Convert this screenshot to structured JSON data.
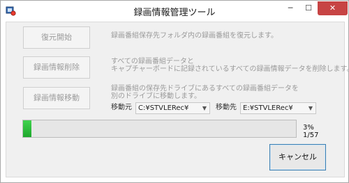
{
  "window": {
    "title": "録画情報管理ツール",
    "min_glyph": "─",
    "max_glyph": "☐",
    "close_glyph": "✕"
  },
  "actions": [
    {
      "label": "復元開始",
      "description": [
        "録画番組保存先フォルダ内の録画番組を復元します。"
      ]
    },
    {
      "label": "録画情報削除",
      "description": [
        "すべての録画番組データと",
        "キャプチャーボードに記録されているすべての録画情報データを削除します。"
      ]
    },
    {
      "label": "録画情報移動",
      "description": [
        "録画番組の保存先ドライブにあるすべての録画番組データを",
        "別のドライブに移動します。"
      ]
    }
  ],
  "move": {
    "source_label": "移動元",
    "source_value": "C:¥STVLERec¥",
    "dest_label": "移動先",
    "dest_value": "E:¥STVLERec¥"
  },
  "progress": {
    "percent_text": "3%",
    "count_text": "1/57",
    "fraction": 0.03,
    "color": "#2bbf3a"
  },
  "cancel_label": "キャンセル"
}
